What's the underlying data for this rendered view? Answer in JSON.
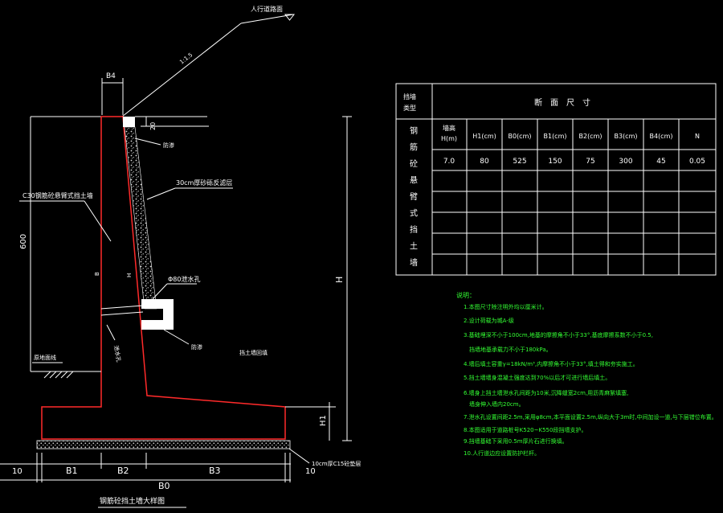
{
  "drawing": {
    "title": "钢筋砼挡土墙大样图",
    "labels": {
      "road_surface": "人行道路面",
      "slope": "1:1.5",
      "b4": "B4",
      "d20": "20",
      "filter_top": "防渗",
      "gravel_layer": "30cm厚砂砾反滤层",
      "wall_concrete": "C30钢筋砼悬臂式挡土墙",
      "drain_pipe": "Φ80泄水孔",
      "wall_h600": "600",
      "big_h": "H",
      "h_inner": "H",
      "b_inner": "B",
      "ground_line": "原地面线",
      "seepage_label": "泄水孔",
      "fill_label": "防渗",
      "backfill_label": "挡土墙回填",
      "h1": "H1",
      "cushion": "10cm厚C15砼垫层",
      "dim_10_left": "10",
      "dim_b1": "B1",
      "dim_b2": "B2",
      "dim_b3": "B3",
      "dim_10_right": "10",
      "dim_b0": "B0"
    }
  },
  "table": {
    "type_header": "挡墙类型",
    "section_header": "断　面　尺　寸",
    "type_name": [
      "钢",
      "筋",
      "砼",
      "悬",
      "臂",
      "式",
      "挡",
      "土",
      "墙"
    ],
    "columns": [
      "墙高H(m)",
      "H1(cm)",
      "B0(cm)",
      "B1(cm)",
      "B2(cm)",
      "B3(cm)",
      "B4(cm)",
      "N"
    ],
    "rows": [
      [
        "7.0",
        "80",
        "525",
        "150",
        "75",
        "300",
        "45",
        "0.05"
      ]
    ]
  },
  "notes": {
    "title": "说明：",
    "items": [
      "1.本图尺寸除注明外均以厘米计。",
      "2.设计荷载为城A-级",
      "3.基础埋深不小于100cm,地基的摩擦角不小于33°,基底摩擦系数不小于0.5,",
      "　挡墙地基承载力不小于180kPa。",
      "4.墙后填土容重γ=18kN/m³,内摩擦角不小于33°,填土得和夯实施工。",
      "5.挡土墙墙身混凝土强度达到70%以后才可进行墙后填土。",
      "6.墙身上挡土墙泄水孔间距为10米,沉降缝宽2cm,用沥青麻絮填塞,",
      "　墙身伸入墙内20cm。",
      "7.泄水孔设置间距2.5m,采用φ8cm,本平面设置2.5m,纵向大于3m时,中间加设一道,与下层错位布置。",
      "8.本图适用于道路桩号K520~K550段挡墙支护。",
      "9.挡墙基础下采用0.5m厚片石进行换填。",
      "10.人行道边应设置防护栏杆。"
    ]
  }
}
